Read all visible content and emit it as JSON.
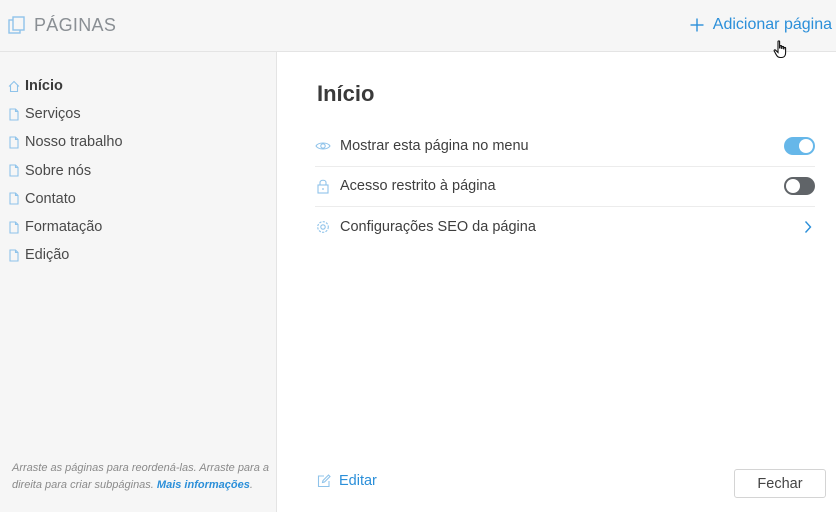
{
  "header": {
    "title": "PÁGINAS",
    "add_page_label": "Adicionar página"
  },
  "sidebar": {
    "items": [
      {
        "label": "Início",
        "icon": "home-icon",
        "active": true
      },
      {
        "label": "Serviços",
        "icon": "page-icon"
      },
      {
        "label": "Nosso trabalho",
        "icon": "page-icon"
      },
      {
        "label": "Sobre nós",
        "icon": "page-icon"
      },
      {
        "label": "Contato",
        "icon": "page-icon"
      },
      {
        "label": "Formatação",
        "icon": "page-icon"
      },
      {
        "label": "Edição",
        "icon": "page-icon"
      }
    ],
    "hint_text": "Arraste as páginas para reordená-las. Arraste para a direita para criar subpáginas.",
    "hint_link": "Mais informações"
  },
  "main": {
    "title": "Início",
    "settings": [
      {
        "label": "Mostrar esta página no menu",
        "icon": "eye-icon",
        "toggle": true
      },
      {
        "label": "Acesso restrito à página",
        "icon": "lock-icon",
        "toggle": false
      },
      {
        "label": "Configurações SEO da página",
        "icon": "gear-icon"
      }
    ],
    "edit_label": "Editar",
    "close_label": "Fechar"
  },
  "colors": {
    "accent": "#2b8fd9",
    "toggle_on": "#66b7e9",
    "toggle_off": "#606468",
    "panel_bg": "#f6f6f6"
  }
}
